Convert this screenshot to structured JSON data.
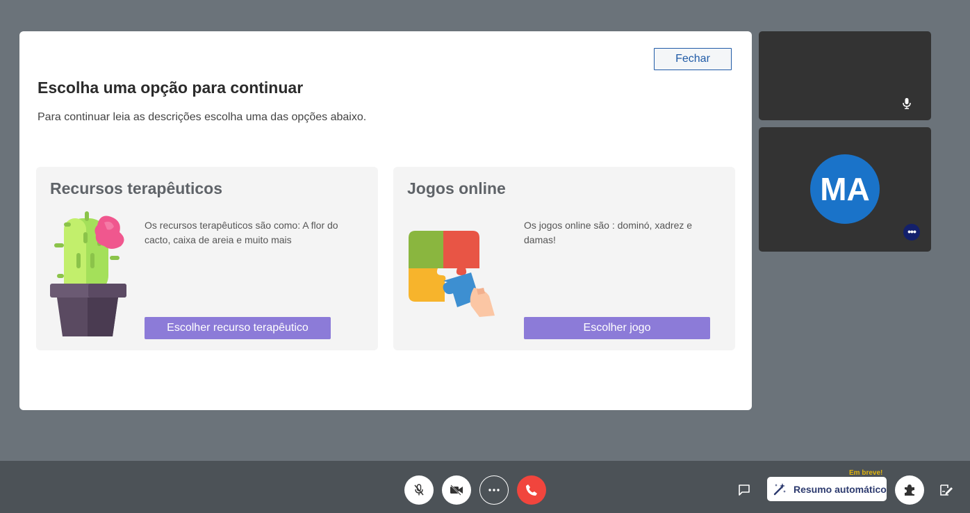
{
  "modal": {
    "close_label": "Fechar",
    "title": "Escolha uma opção para continuar",
    "subtitle": "Para continuar leia as descrições escolha uma das opções abaixo.",
    "cards": [
      {
        "title": "Recursos terapêuticos",
        "description": "Os recursos terapêuticos são como: A flor do cacto, caixa de areia e muito mais",
        "button_label": "Escolher recurso terapêutico",
        "illustration": "cactus-pot"
      },
      {
        "title": "Jogos online",
        "description": "Os jogos online são : dominó, xadrez e damas!",
        "button_label": "Escolher jogo",
        "illustration": "puzzle-pieces"
      }
    ]
  },
  "participants": {
    "tiles": [
      {
        "icon": "mic-icon"
      },
      {
        "initials": "MA",
        "avatar_color": "#1a73c9",
        "menu_icon": "more-dots-icon"
      }
    ]
  },
  "toolbar": {
    "controls": [
      {
        "icon": "mic-off-icon"
      },
      {
        "icon": "camera-off-icon"
      },
      {
        "icon": "more-options-icon"
      },
      {
        "icon": "hang-up-icon",
        "color": "#f1453d"
      }
    ],
    "chat_icon": "chat-icon",
    "summary": {
      "label": "Resumo automático",
      "badge": "Em breve!",
      "icon": "magic-wand-icon"
    },
    "extensions_icon": "puzzle-icon",
    "notes_icon": "notes-icon"
  },
  "colors": {
    "background": "#6b737a",
    "accent": "#8c7bd8",
    "toolbar": "#4c5257"
  }
}
